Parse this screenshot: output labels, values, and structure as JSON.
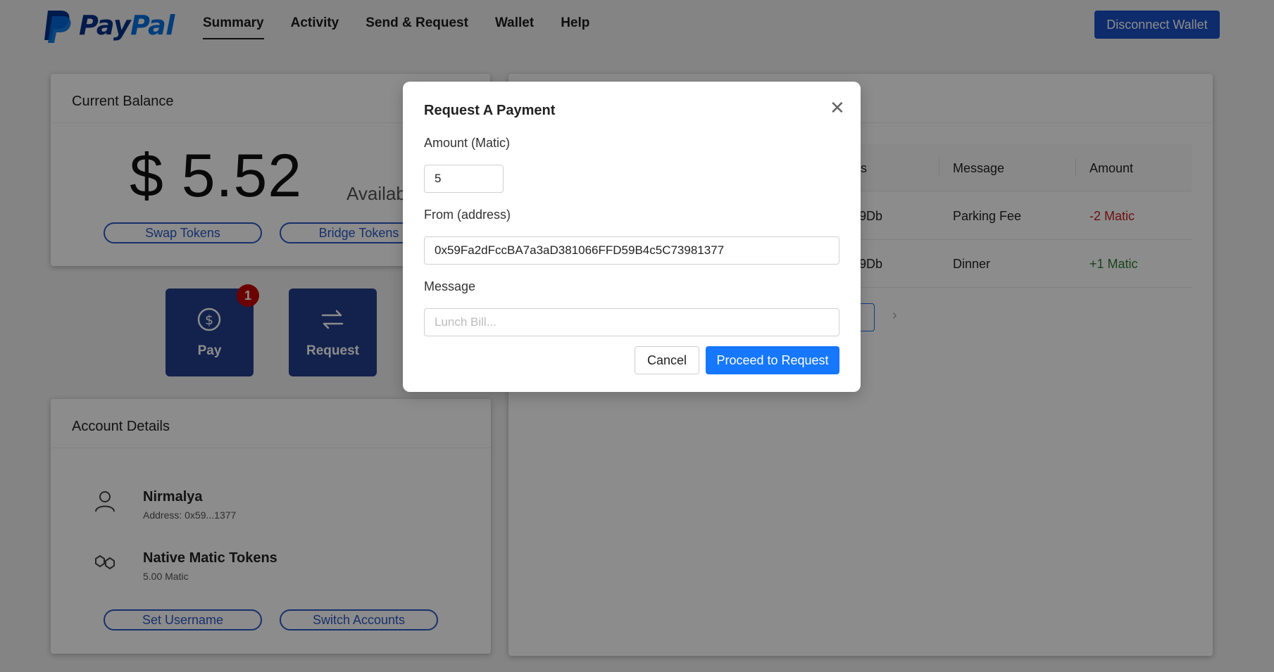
{
  "header": {
    "logo_text_1": "Pay",
    "logo_text_2": "Pal",
    "nav": [
      {
        "label": "Summary"
      },
      {
        "label": "Activity"
      },
      {
        "label": "Send & Request"
      },
      {
        "label": "Wallet"
      },
      {
        "label": "Help"
      }
    ],
    "disconnect_label": "Disconnect Wallet"
  },
  "balance": {
    "title": "Current Balance",
    "amount": "$ 5.52",
    "available_label": "Availabl",
    "swap_label": "Swap Tokens",
    "bridge_label": "Bridge Tokens"
  },
  "actions": {
    "pay_label": "Pay",
    "pay_badge": "1",
    "request_label": "Request"
  },
  "account": {
    "title": "Account Details",
    "name": "Nirmalya",
    "address": "Address: 0x59...1377",
    "token_name": "Native Matic Tokens",
    "token_amount": "5.00 Matic",
    "set_username_label": "Set Username",
    "switch_accounts_label": "Switch Accounts"
  },
  "history": {
    "col_partial": "s",
    "col_message": "Message",
    "col_amount": "Amount",
    "rows": [
      {
        "address_partial": "9Db",
        "message": "Parking Fee",
        "amount": "-2 Matic"
      },
      {
        "address_partial": "9Db",
        "message": "Dinner",
        "amount": "+1 Matic"
      }
    ],
    "page_next": "›"
  },
  "modal": {
    "title": "Request A Payment",
    "close": "✕",
    "amount_label": "Amount (Matic)",
    "amount_value": "5",
    "from_label": "From (address)",
    "from_value": "0x59Fa2dFccBA7a3aD381066FFD59B4c5C73981377",
    "message_label": "Message",
    "message_placeholder": "Lunch Bill...",
    "cancel_label": "Cancel",
    "proceed_label": "Proceed to Request"
  },
  "colors": {
    "brand_dark": "#003087",
    "brand_light": "#0070e0",
    "tile_bg": "#213f8a",
    "primary_button": "#1677ff",
    "negative": "#c81e1e",
    "positive": "#2e7d32"
  }
}
